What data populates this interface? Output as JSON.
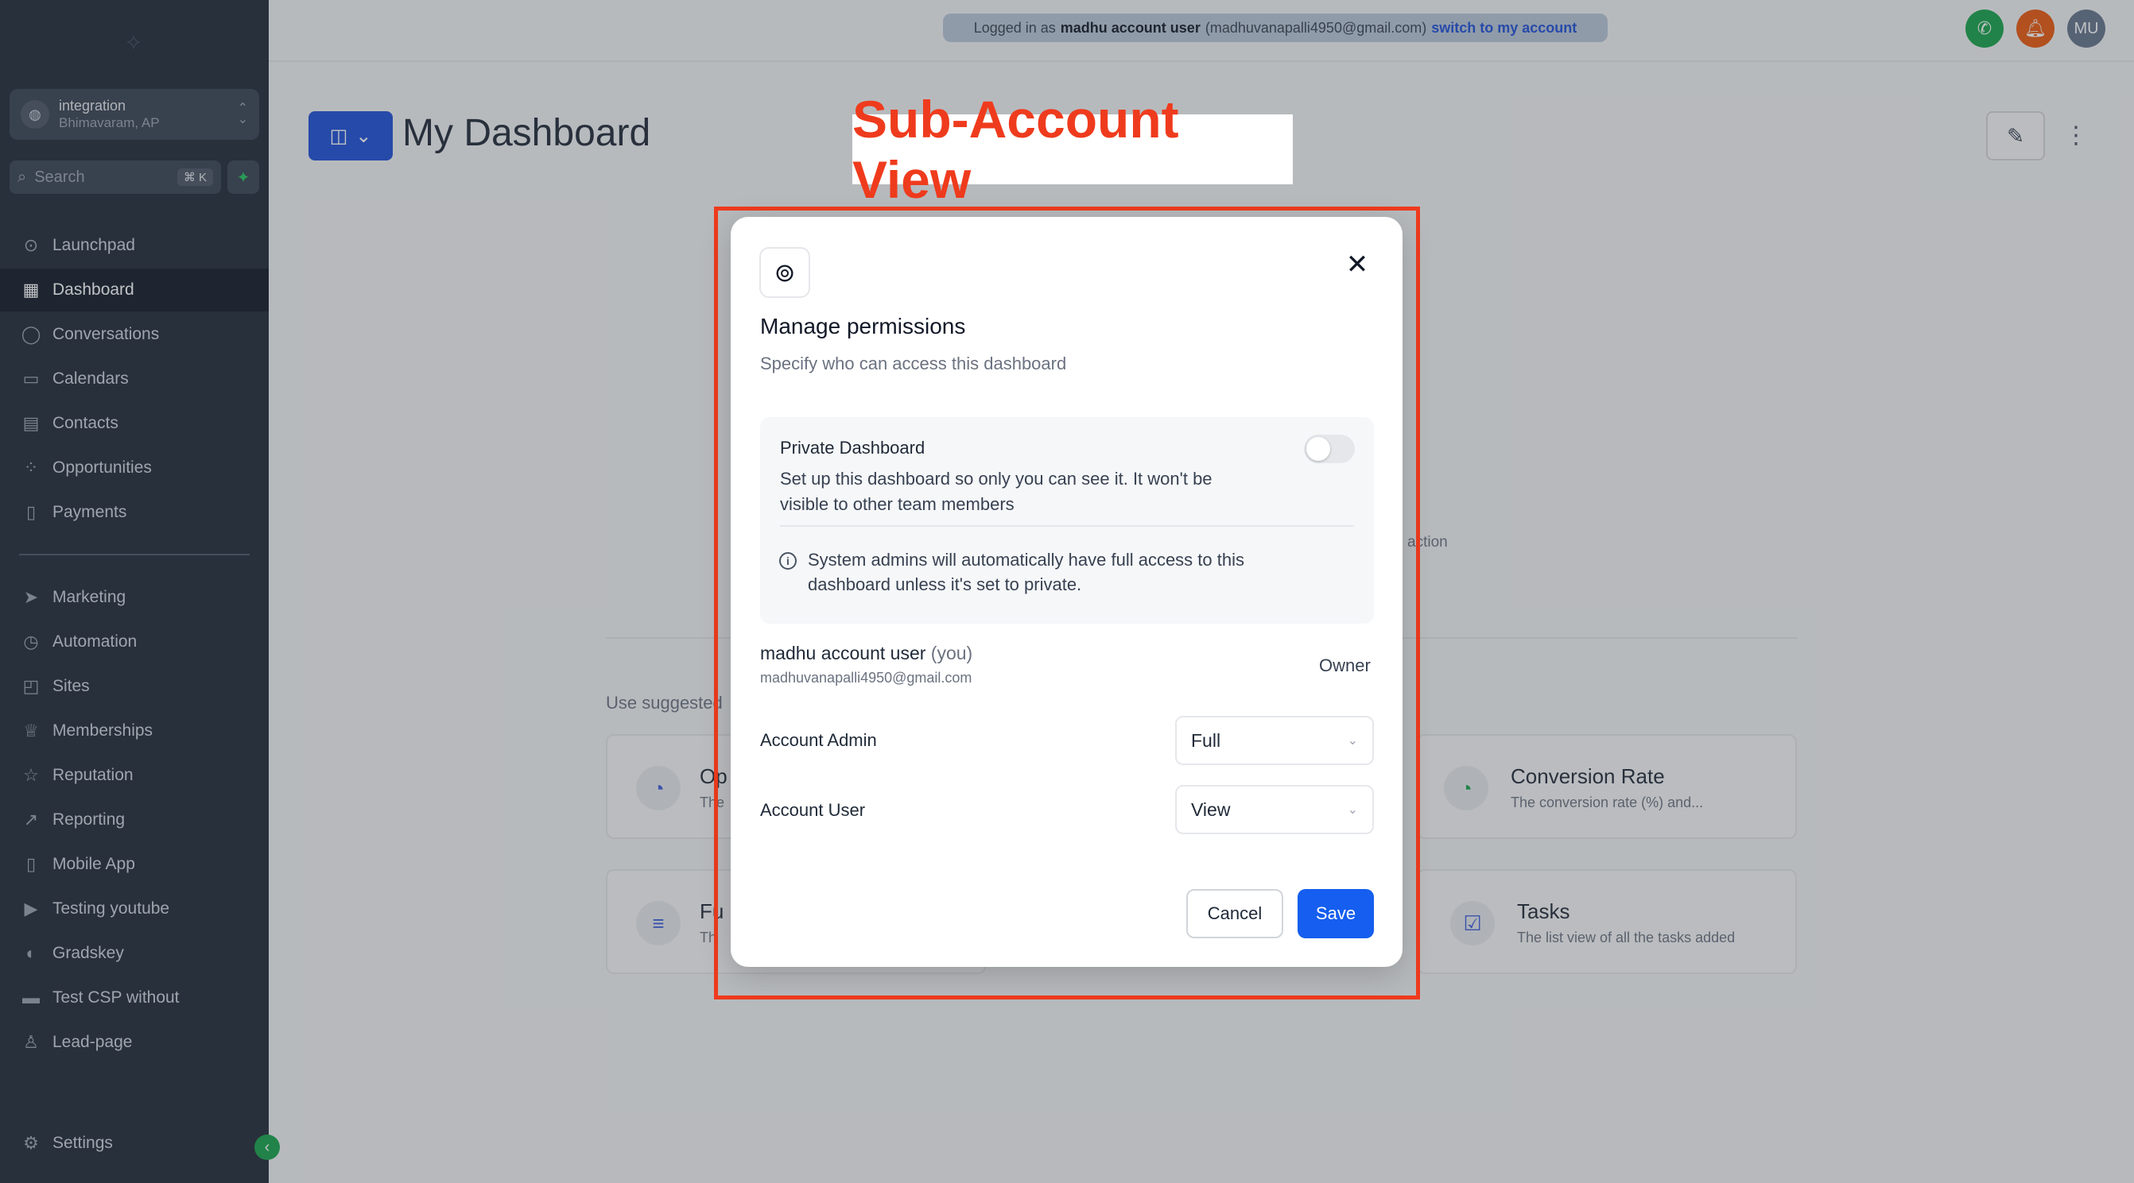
{
  "sidebar": {
    "location": {
      "name": "integration",
      "address": "Bhimavaram, AP"
    },
    "search": {
      "placeholder": "Search",
      "shortcut": "⌘ K"
    },
    "items": [
      {
        "label": "Launchpad",
        "icon": "launchpad-icon"
      },
      {
        "label": "Dashboard",
        "icon": "dashboard-icon",
        "active": true
      },
      {
        "label": "Conversations",
        "icon": "chat-bubble-icon"
      },
      {
        "label": "Calendars",
        "icon": "calendar-icon"
      },
      {
        "label": "Contacts",
        "icon": "contacts-icon"
      },
      {
        "label": "Opportunities",
        "icon": "opportunities-icon"
      },
      {
        "label": "Payments",
        "icon": "payments-icon"
      },
      {
        "label": "Marketing",
        "icon": "send-icon"
      },
      {
        "label": "Automation",
        "icon": "automation-icon"
      },
      {
        "label": "Sites",
        "icon": "sites-icon"
      },
      {
        "label": "Memberships",
        "icon": "memberships-icon"
      },
      {
        "label": "Reputation",
        "icon": "star-icon"
      },
      {
        "label": "Reporting",
        "icon": "trend-icon"
      },
      {
        "label": "Mobile App",
        "icon": "mobile-icon"
      },
      {
        "label": "Testing youtube",
        "icon": "youtube-icon"
      },
      {
        "label": "Gradskey",
        "icon": "globe-icon"
      },
      {
        "label": "Test CSP without",
        "icon": "card-icon"
      },
      {
        "label": "Lead-page",
        "icon": "person-icon"
      }
    ],
    "settings_label": "Settings"
  },
  "topbar": {
    "prefix": "Logged in as",
    "user": "madhu account user",
    "email": "(madhuvanapalli4950@gmail.com)",
    "switch_link": "switch to my account",
    "avatar_initials": "MU",
    "colors": {
      "phone": "#16a34a",
      "bell": "#ea580c",
      "avatar": "#64748b"
    }
  },
  "page": {
    "title": "My Dashboard",
    "suggested_label": "Use suggested",
    "action_fragment": "action",
    "cards": [
      {
        "title": "Op",
        "desc": "The",
        "icon": "pie-chart-icon"
      },
      {
        "title": "Conversion Rate",
        "desc": "The conversion rate (%) and...",
        "icon": "pie-chart-icon"
      },
      {
        "title": "Fu",
        "desc": "Th",
        "icon": "funnel-icon"
      },
      {
        "title": "Tasks",
        "desc": "The list view of all the tasks added",
        "icon": "clipboard-icon"
      }
    ]
  },
  "annotation": {
    "label": "Sub-Account View",
    "color": "#ef3b1d"
  },
  "modal": {
    "title": "Manage permissions",
    "subtitle": "Specify who can access this dashboard",
    "private": {
      "title": "Private Dashboard",
      "description": "Set up this dashboard so only you can see it. It won't be visible to other team members",
      "enabled": false
    },
    "info": "System admins will automatically have full access to this dashboard unless it's set to private.",
    "owner": {
      "name": "madhu account user",
      "you": "(you)",
      "email": "madhuvanapalli4950@gmail.com",
      "role": "Owner"
    },
    "permissions": [
      {
        "label": "Account Admin",
        "value": "Full"
      },
      {
        "label": "Account User",
        "value": "View"
      }
    ],
    "cancel_label": "Cancel",
    "save_label": "Save",
    "accent": "#155eef"
  }
}
